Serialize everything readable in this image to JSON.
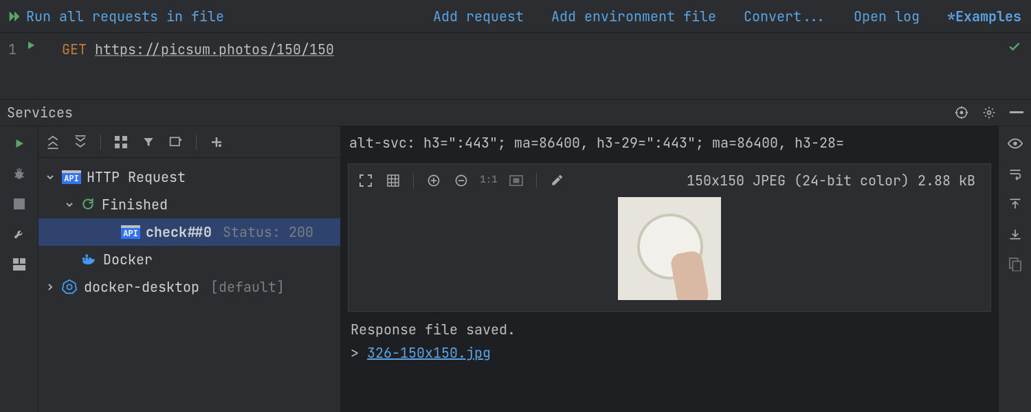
{
  "toolbar": {
    "run_all": "Run all requests in file",
    "add_request": "Add request",
    "add_env_file": "Add environment file",
    "convert": "Convert...",
    "open_log": "Open log",
    "examples": "*Examples"
  },
  "editor": {
    "line_number": "1",
    "method": "GET",
    "url": "https://picsum.photos/150/150"
  },
  "services": {
    "title": "Services"
  },
  "tree": {
    "http_request": "HTTP Request",
    "finished": "Finished",
    "check_item": "check##0",
    "check_status": "Status: 200",
    "docker": "Docker",
    "k8s": "docker-desktop",
    "k8s_default": "[default]"
  },
  "response": {
    "header_line": "alt-svc: h3=\":443\"; ma=86400, h3-29=\":443\"; ma=86400, h3-28=",
    "image_meta": "150x150 JPEG (24-bit color) 2.88 kB",
    "saved": "Response file saved.",
    "link_prefix": "> ",
    "file_link": "326-150x150.jpg"
  },
  "toolbar_icons": {
    "one_to_one": "1:1",
    "api": "API"
  }
}
